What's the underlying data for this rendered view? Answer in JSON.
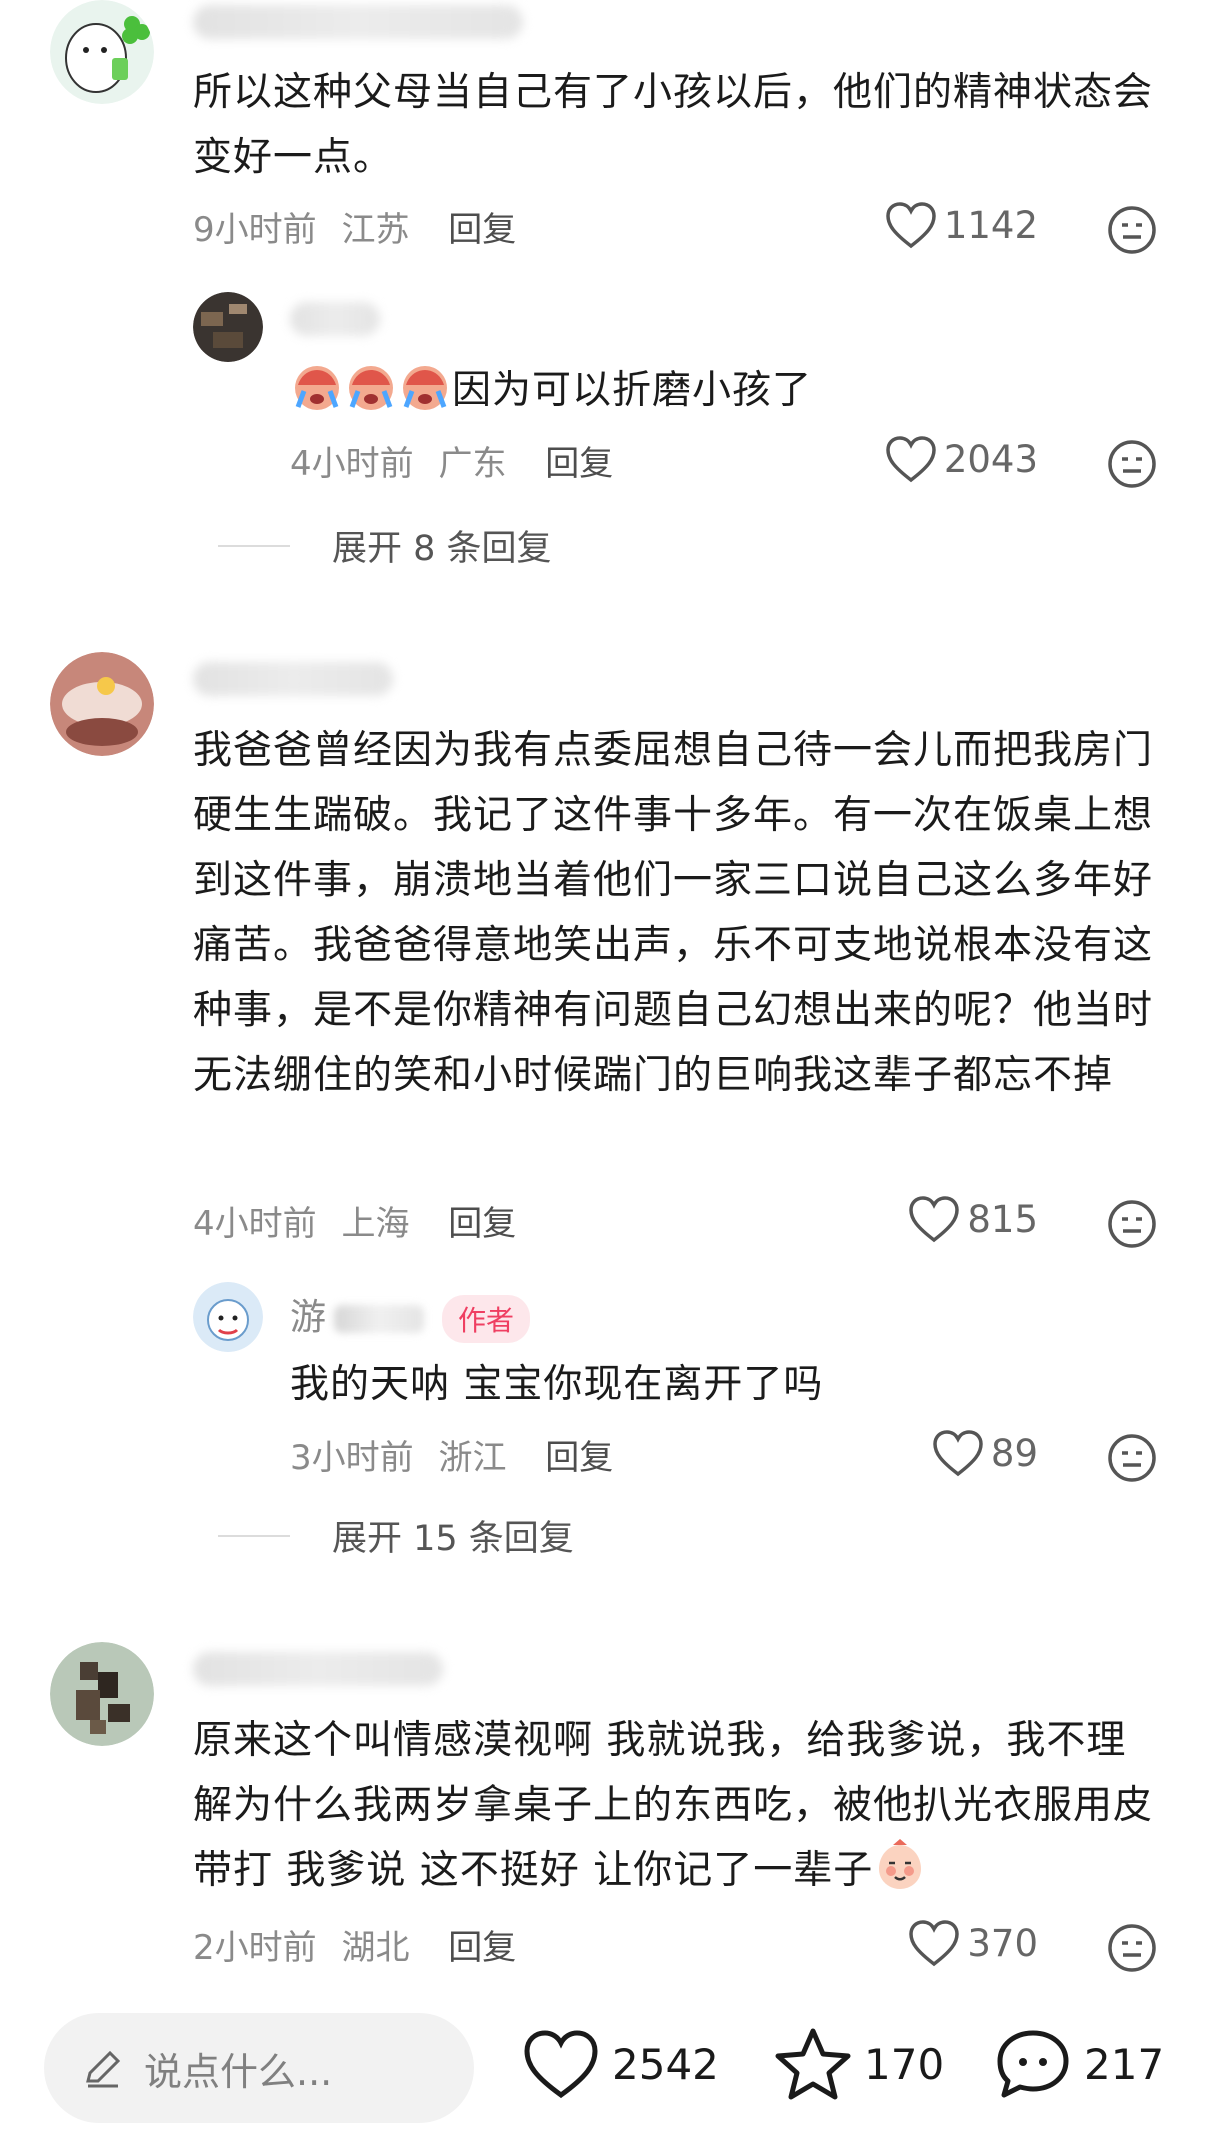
{
  "comments": [
    {
      "text": "所以这种父母当自己有了小孩以后，他们的精神状态会变好一点。",
      "time": "9小时前",
      "location": "江苏",
      "reply_label": "回复",
      "likes": "1142",
      "replies": [
        {
          "text": "因为可以折磨小孩了",
          "time": "4小时前",
          "location": "广东",
          "reply_label": "回复",
          "likes": "2043"
        }
      ],
      "expand_label": "展开 8 条回复"
    },
    {
      "text": "我爸爸曾经因为我有点委屈想自己待一会儿而把我房门硬生生踹破。我记了这件事十多年。有一次在饭桌上想到这件事，崩溃地当着他们一家三口说自己这么多年好痛苦。我爸爸得意地笑出声，乐不可支地说根本没有这种事，是不是你精神有问题自己幻想出来的呢？他当时无法绷住的笑和小时候踹门的巨响我这辈子都忘不掉",
      "time": "4小时前",
      "location": "上海",
      "reply_label": "回复",
      "likes": "815",
      "replies": [
        {
          "name": "游",
          "badge": "作者",
          "text": "我的天呐 宝宝你现在离开了吗",
          "time": "3小时前",
          "location": "浙江",
          "reply_label": "回复",
          "likes": "89"
        }
      ],
      "expand_label": "展开 15 条回复"
    },
    {
      "text": "原来这个叫情感漠视啊 我就说我，给我爹说，我不理解为什么我两岁拿桌子上的东西吃，被他扒光衣服用皮带打 我爹说 这不挺好 让你记了一辈子",
      "time": "2小时前",
      "location": "湖北",
      "reply_label": "回复",
      "likes": "370"
    }
  ],
  "bottom_bar": {
    "input_placeholder": "说点什么...",
    "likes": "2542",
    "favorites": "170",
    "comments": "217"
  },
  "icons": [
    "heart-icon",
    "neutral-face-icon",
    "pencil-icon",
    "star-icon",
    "chat-bubble-icon",
    "crying-emoji-icon",
    "blush-emoji-icon"
  ],
  "colors": {
    "author_badge_bg": "#fde7eb",
    "author_badge_text": "#ef3f62",
    "meta_gray": "#8a8a8a"
  }
}
